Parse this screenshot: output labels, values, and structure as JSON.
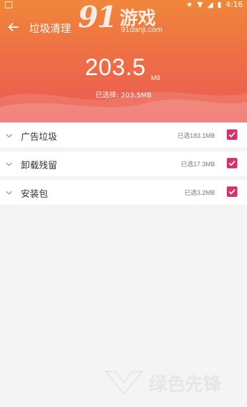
{
  "status_bar": {
    "time": "4:16"
  },
  "header": {
    "title": "垃圾清理",
    "watermark_number": "91",
    "watermark_text": "游戏",
    "watermark_url": "91danji.com",
    "size_value": "203.5",
    "size_unit": "MB",
    "selected_label": "已选择: 203.5MB"
  },
  "categories": [
    {
      "label": "广告垃圾",
      "size": "已选183.1MB",
      "checked": true
    },
    {
      "label": "卸载残留",
      "size": "已选17.3MB",
      "checked": true
    },
    {
      "label": "安装包",
      "size": "已选3.2MB",
      "checked": true
    }
  ],
  "colors": {
    "accent": "#d6336c",
    "header_top": "#f0873a",
    "header_bottom": "#ec5a54"
  },
  "bottom_watermark": "绿色先锋"
}
